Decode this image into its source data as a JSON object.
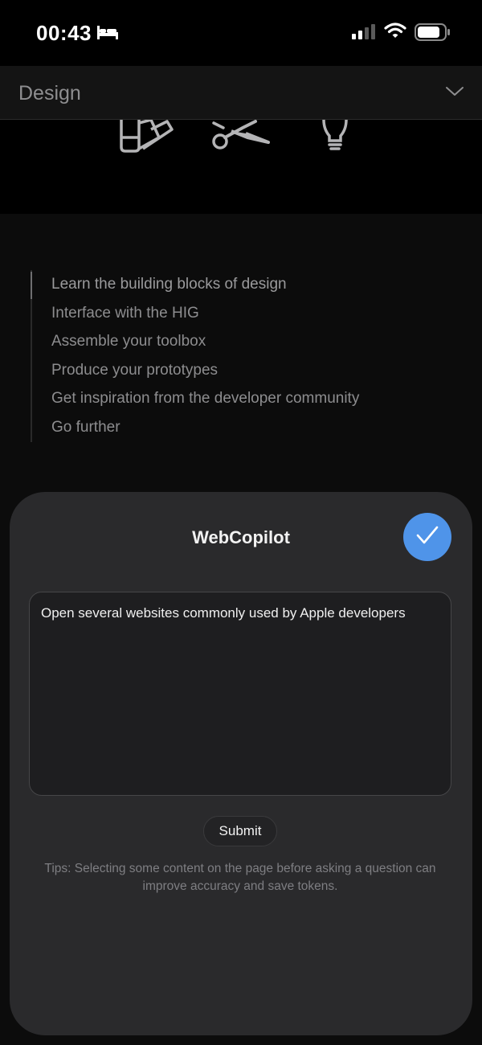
{
  "status_bar": {
    "time": "00:43",
    "icons": [
      "sleep-icon",
      "cellular-signal-icon",
      "wifi-icon",
      "battery-icon"
    ]
  },
  "nav": {
    "title": "Design",
    "expand_icon": "chevron-down-icon"
  },
  "hero": {
    "icons": [
      "color-swatches-icon",
      "scissors-icon",
      "lightbulb-icon"
    ]
  },
  "toc": {
    "items": [
      {
        "label": "Learn the building blocks of design"
      },
      {
        "label": "Interface with the HIG"
      },
      {
        "label": "Assemble your toolbox"
      },
      {
        "label": "Produce your prototypes"
      },
      {
        "label": "Get inspiration from the developer community"
      },
      {
        "label": "Go further"
      }
    ]
  },
  "sheet": {
    "title": "WebCopilot",
    "confirm_icon": "checkmark-icon",
    "prompt_text": "Open several websites commonly used by Apple developers",
    "submit_label": "Submit",
    "tips": "Tips: Selecting some content on the page before asking a question can improve accuracy and save tokens."
  },
  "colors": {
    "accent": "#4f94e9",
    "sheet_background": "#2a2a2c",
    "page_background": "#0c0c0c"
  }
}
